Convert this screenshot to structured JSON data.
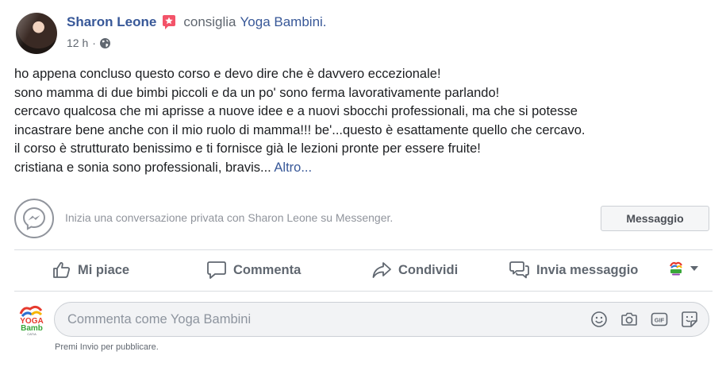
{
  "post": {
    "author_name": "Sharon Leone",
    "recommends_text": "consiglia",
    "page_name": "Yoga Bambini.",
    "time": "12 h",
    "separator": "·",
    "body_lines": [
      "ho appena concluso questo corso e devo dire che è davvero eccezionale!",
      "sono mamma di due bimbi piccoli e da un po' sono ferma lavorativamente parlando!",
      "cercavo qualcosa che mi aprisse a nuove idee e a nuovi sbocchi professionali, ma che si potesse",
      "incastrare bene anche con il mio ruolo di mamma!!! be'...questo è esattamente quello che cercavo.",
      "il corso è strutturato benissimo e ti fornisce già le lezioni pronte per essere fruite!",
      "cristiana e sonia sono professionali, bravis... "
    ],
    "more_label": "Altro..."
  },
  "messenger": {
    "prompt": "Inizia una conversazione privata con Sharon Leone su Messenger.",
    "button_label": "Messaggio"
  },
  "actions": {
    "like": "Mi piace",
    "comment": "Commenta",
    "share": "Condividi",
    "send": "Invia messaggio"
  },
  "composer": {
    "placeholder": "Commenta come Yoga Bambini",
    "hint": "Premi Invio per pubblicare."
  },
  "logo": {
    "line1": "YOGA",
    "line2": "Bamb",
    "line3": "CATIA"
  },
  "colors": {
    "link": "#385898",
    "muted": "#606770",
    "badge": "#f35369"
  }
}
